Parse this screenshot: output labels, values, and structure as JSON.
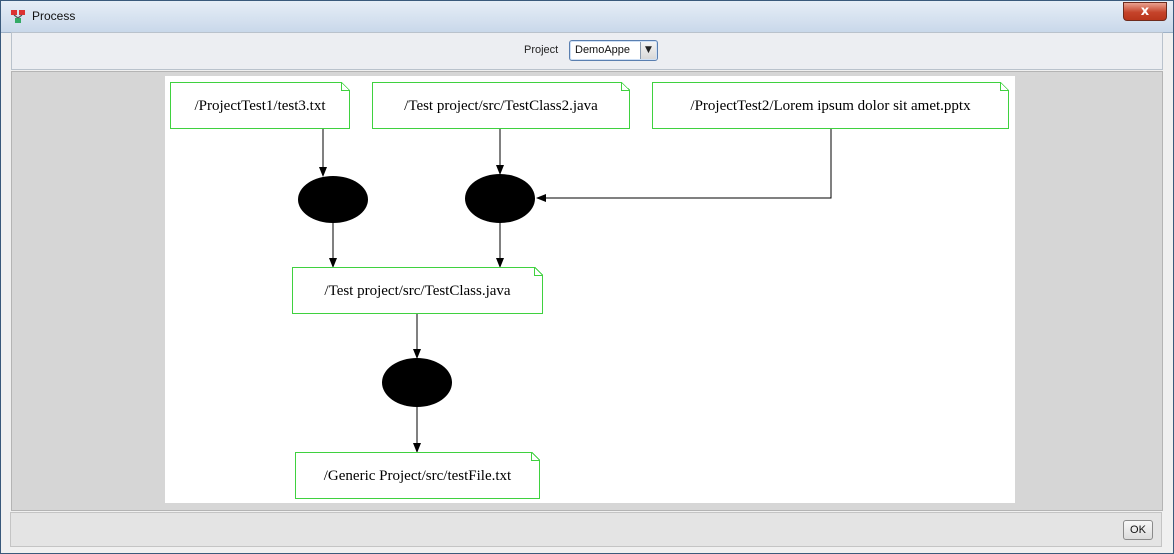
{
  "window": {
    "title": "Process",
    "close_label": "x"
  },
  "toolbar": {
    "project_label": "Project",
    "project_value": "DemoAppe",
    "dropdown_arrow": "▼"
  },
  "graph": {
    "nodes": {
      "test3": "/ProjectTest1/test3.txt",
      "testclass2": "/Test project/src/TestClass2.java",
      "pptx": "/ProjectTest2/Lorem ipsum dolor sit amet.pptx",
      "testclass": "/Test project/src/TestClass.java",
      "testfile": "/Generic Project/src/testFile.txt"
    }
  },
  "footer": {
    "ok_label": "OK"
  }
}
